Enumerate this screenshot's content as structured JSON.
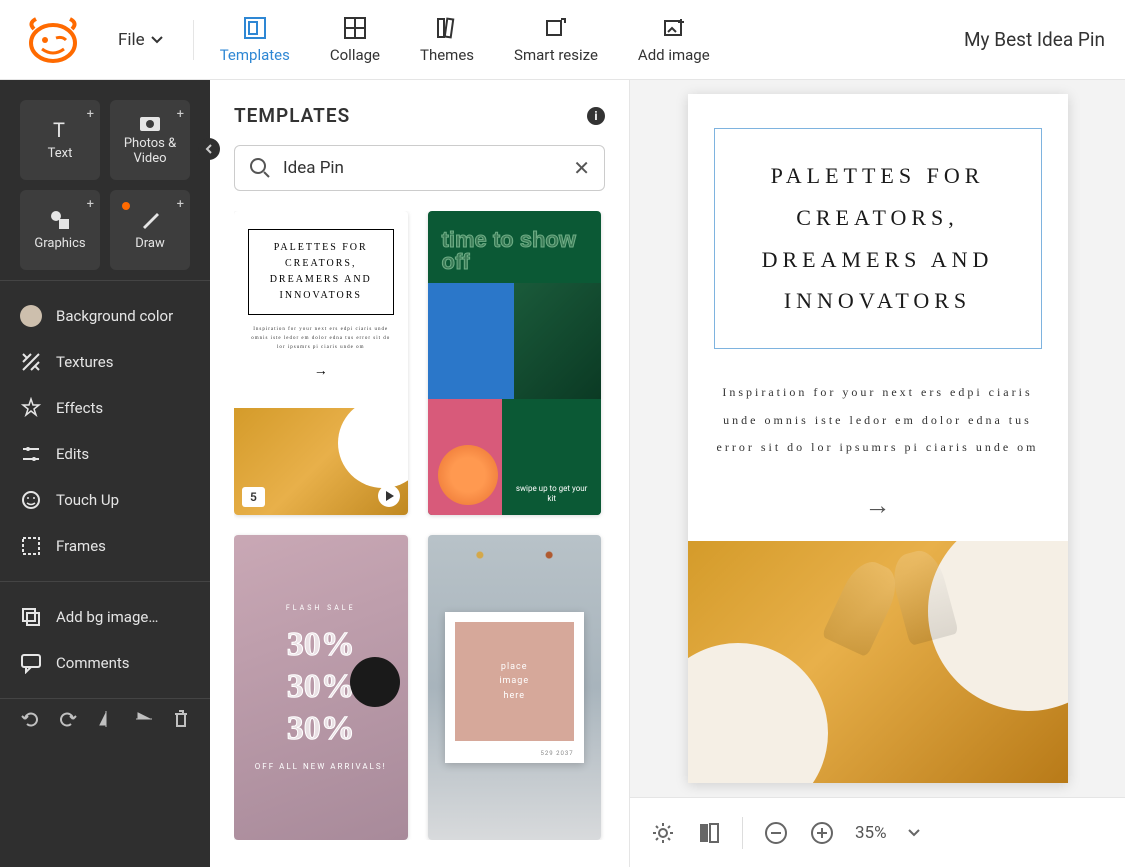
{
  "app": {
    "doc_title": "My Best Idea Pin",
    "file_menu": "File"
  },
  "toolbar": {
    "templates": "Templates",
    "collage": "Collage",
    "themes": "Themes",
    "smart_resize": "Smart resize",
    "add_image": "Add image"
  },
  "sidebar": {
    "tiles": {
      "text": "Text",
      "photos": "Photos & Video",
      "graphics": "Graphics",
      "draw": "Draw"
    },
    "items": {
      "bg_color": "Background color",
      "textures": "Textures",
      "effects": "Effects",
      "edits": "Edits",
      "touch_up": "Touch Up",
      "frames": "Frames",
      "add_bg": "Add bg image…",
      "comments": "Comments"
    }
  },
  "panel": {
    "title": "TEMPLATES",
    "search_value": "Idea Pin",
    "thumbs": {
      "t1": {
        "title": "PALETTES FOR CREATORS, DREAMERS AND INNOVATORS",
        "sub": "Inspiration for your next ers edpi ciaris unde omnis iste ledor em dolor edna tus error sit do lor ipsumrs pi ciaris unde om",
        "badge": "5"
      },
      "t2": {
        "title": "time to show off",
        "swipe": "swipe up to get your kit"
      },
      "t3": {
        "label": "FLASH SALE",
        "pct": "30%",
        "sub": "OFF ALL NEW ARRIVALS!"
      },
      "t4": {
        "place1": "place",
        "place2": "image",
        "place3": "here",
        "date": "529 2037"
      }
    }
  },
  "canvas": {
    "title": "PALETTES FOR CREATORS, DREAMERS AND INNOVATORS",
    "sub": "Inspiration for your next ers edpi ciaris unde omnis iste ledor em dolor edna tus error sit do lor ipsumrs pi ciaris unde om"
  },
  "zoom": {
    "level": "35%"
  }
}
